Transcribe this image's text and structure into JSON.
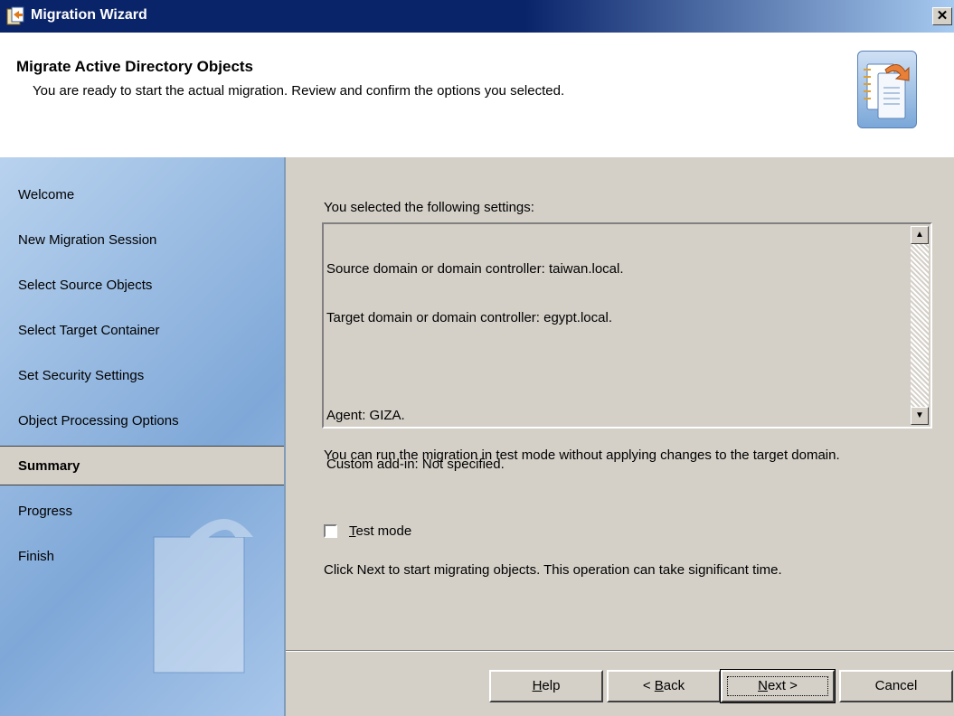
{
  "window": {
    "title": "Migration Wizard",
    "close_glyph": "✕"
  },
  "header": {
    "title": "Migrate Active Directory Objects",
    "subtitle": "You are ready to start the actual migration. Review and confirm the options you selected.",
    "icon": "wizard-document-icon"
  },
  "sidebar": {
    "items": [
      {
        "label": "Welcome"
      },
      {
        "label": "New Migration Session"
      },
      {
        "label": "Select Source Objects"
      },
      {
        "label": "Select Target Container"
      },
      {
        "label": "Set Security Settings"
      },
      {
        "label": "Object Processing Options"
      },
      {
        "label": "Summary",
        "selected": true
      },
      {
        "label": "Progress"
      },
      {
        "label": "Finish"
      }
    ]
  },
  "main": {
    "settings_label": "You selected the following settings:",
    "settings_lines": [
      "Source domain or domain controller: taiwan.local.",
      "Target domain or domain controller: egypt.local.",
      "",
      "Agent: GIZA.",
      "Custom add-in: Not specified."
    ],
    "test_mode_description": "You can run the migration in test mode without applying changes to the target domain.",
    "test_mode_checkbox": {
      "label_accel": "T",
      "label_rest": "est mode",
      "checked": false
    },
    "next_description": "Click Next to start migrating objects. This operation can take significant time."
  },
  "buttons": {
    "help": {
      "accel": "H",
      "rest": "elp"
    },
    "back": {
      "prefix": "< ",
      "accel": "B",
      "rest": "ack"
    },
    "next": {
      "accel": "N",
      "rest": "ext >"
    },
    "cancel": {
      "label": "Cancel"
    }
  },
  "colors": {
    "title_bar": "#0a246a",
    "sidebar": "#7fa8d8",
    "dialog_bg": "#d4d0c8"
  }
}
